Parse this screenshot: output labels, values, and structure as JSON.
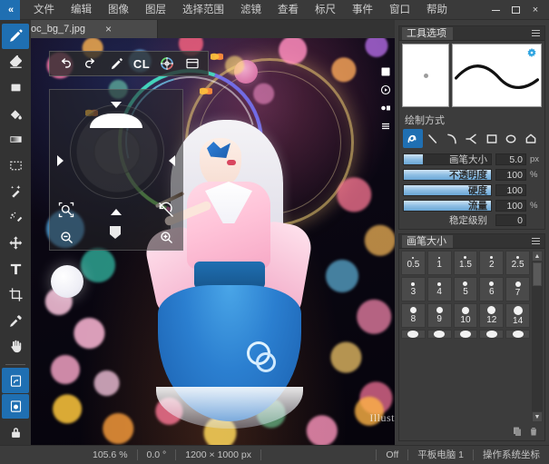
{
  "app": {
    "logo": "«",
    "menu": [
      "文件",
      "编辑",
      "图像",
      "图层",
      "选择范围",
      "滤镜",
      "查看",
      "标尺",
      "事件",
      "窗口",
      "帮助"
    ],
    "window_controls": {
      "minimize": "minimize-icon",
      "maximize": "maximize-icon",
      "close": "×"
    }
  },
  "tabs": [
    {
      "label": "oc_bg_7.jpg",
      "close": "×",
      "active": true
    }
  ],
  "toolbar": {
    "tools": [
      {
        "name": "pencil-tool",
        "active": true
      },
      {
        "name": "eraser-tool",
        "active": false
      },
      {
        "name": "fill-tool",
        "active": false
      },
      {
        "name": "paint-bucket-tool",
        "active": false
      },
      {
        "name": "gradient-tool",
        "active": false
      },
      {
        "name": "marquee-select-tool",
        "active": false
      },
      {
        "name": "magic-wand-tool",
        "active": false
      },
      {
        "name": "lasso-select-tool",
        "active": false
      },
      {
        "name": "move-tool",
        "active": false
      },
      {
        "name": "text-tool",
        "active": false
      },
      {
        "name": "crop-tool",
        "active": false
      },
      {
        "name": "eyedropper-tool",
        "active": false
      },
      {
        "name": "hand-tool",
        "active": false
      },
      {
        "name": "canvas-rotate-tool",
        "active": true
      },
      {
        "name": "quick-mask-tool",
        "active": true
      },
      {
        "name": "lock-tool",
        "active": false
      }
    ]
  },
  "float_toolbar": {
    "undo": "undo-icon",
    "redo": "redo-icon",
    "brush": "pencil-icon",
    "cl_label": "CL",
    "color_wheel": "color-wheel-icon",
    "layers": "layers-icon"
  },
  "canvas": {
    "watermark": "Illust"
  },
  "tool_options": {
    "title": "工具选项",
    "drawing_method_label": "绘制方式",
    "methods": [
      {
        "name": "freehand",
        "active": true
      },
      {
        "name": "straight-line",
        "active": false
      },
      {
        "name": "curve",
        "active": false
      },
      {
        "name": "polyline",
        "active": false
      },
      {
        "name": "rectangle",
        "active": false
      },
      {
        "name": "ellipse",
        "active": false
      },
      {
        "name": "polygon",
        "active": false
      }
    ],
    "sliders": [
      {
        "label": "画笔大小",
        "value": "5.0",
        "unit": "px",
        "fill": 22
      },
      {
        "label": "不透明度",
        "value": "100",
        "unit": "%",
        "fill": 100
      },
      {
        "label": "硬度",
        "value": "100",
        "unit": "",
        "fill": 100
      },
      {
        "label": "流量",
        "value": "100",
        "unit": "%",
        "fill": 100
      },
      {
        "label": "稳定级别",
        "value": "0",
        "unit": "",
        "fill": 0
      }
    ]
  },
  "brush_size_panel": {
    "title": "画笔大小",
    "sizes": [
      {
        "label": "0.5",
        "dot": 2
      },
      {
        "label": "1",
        "dot": 2
      },
      {
        "label": "1.5",
        "dot": 3
      },
      {
        "label": "2",
        "dot": 3
      },
      {
        "label": "2.5",
        "dot": 3
      },
      {
        "label": "3",
        "dot": 4
      },
      {
        "label": "4",
        "dot": 4
      },
      {
        "label": "5",
        "dot": 5
      },
      {
        "label": "6",
        "dot": 5
      },
      {
        "label": "7",
        "dot": 6
      },
      {
        "label": "8",
        "dot": 7
      },
      {
        "label": "9",
        "dot": 7
      },
      {
        "label": "10",
        "dot": 8
      },
      {
        "label": "12",
        "dot": 9
      },
      {
        "label": "14",
        "dot": 10
      }
    ],
    "footer": {
      "duplicate": "duplicate-icon",
      "delete": "trash-icon"
    }
  },
  "statusbar": {
    "zoom": "105.6 %",
    "rotation": "0.0 °",
    "dimensions": "1200 × 1000 px",
    "pen_state": "Off",
    "device": "平板电脑 1",
    "coords": "操作系统坐标"
  }
}
